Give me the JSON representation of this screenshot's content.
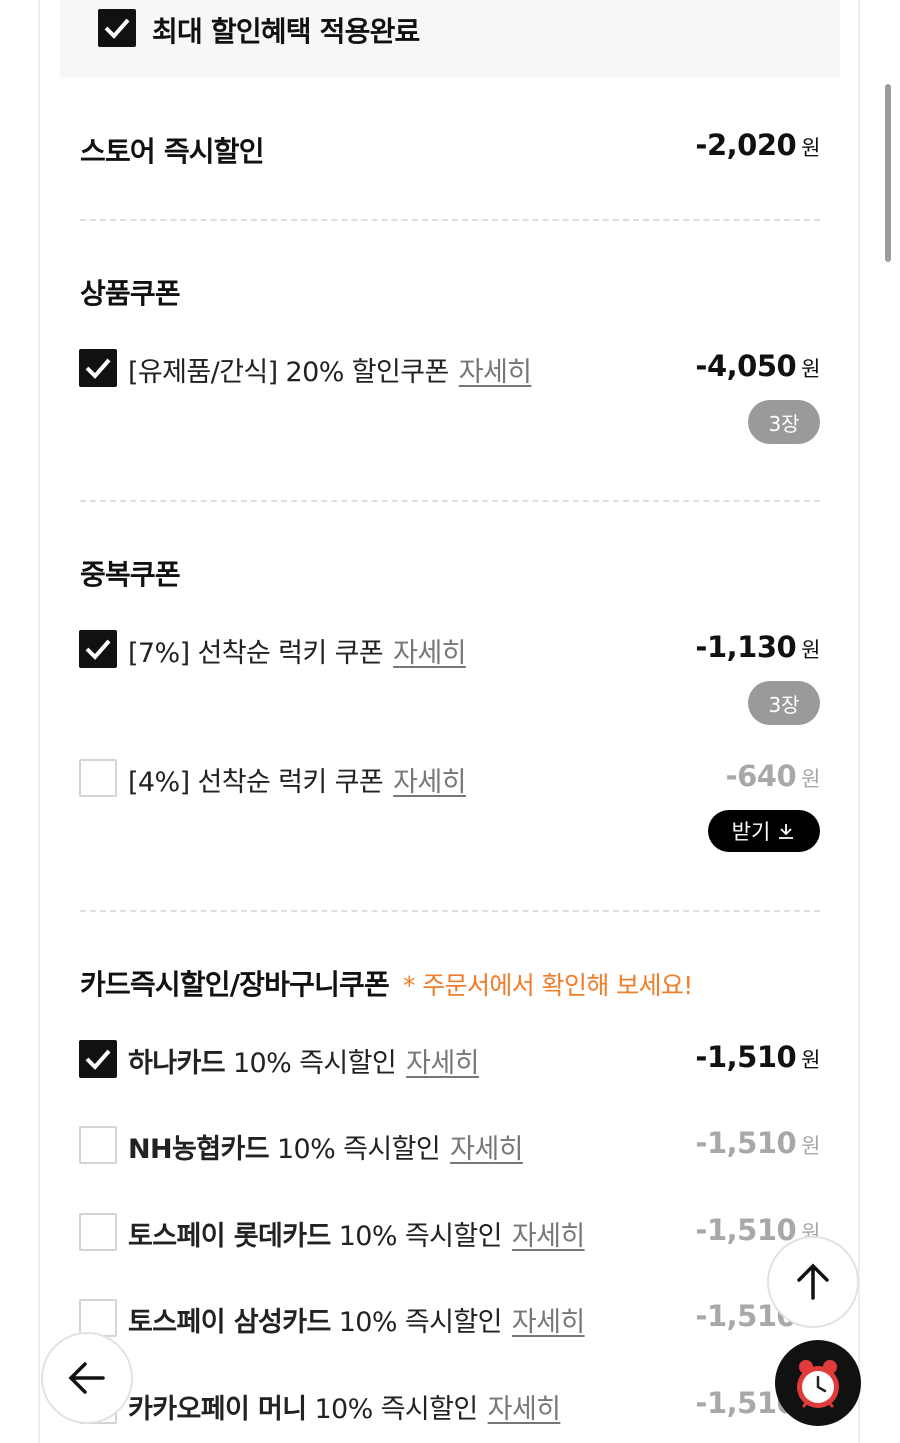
{
  "header": {
    "max_discount_label": "최대 할인혜택 적용완료"
  },
  "store_discount": {
    "label": "스토어 즉시할인",
    "amount": "-2,020",
    "unit": "원"
  },
  "product_coupon": {
    "title": "상품쿠폰",
    "items": [
      {
        "label": "[유제품/간식] 20% 할인쿠폰",
        "detail": "자세히",
        "amount": "-4,050",
        "unit": "원",
        "count": "3장",
        "checked": true
      }
    ]
  },
  "duplicate_coupon": {
    "title": "중복쿠폰",
    "items": [
      {
        "label": "[7%] 선착순 럭키 쿠폰",
        "detail": "자세히",
        "amount": "-1,130",
        "unit": "원",
        "count": "3장",
        "checked": true
      },
      {
        "label": "[4%] 선착순 럭키 쿠폰",
        "detail": "자세히",
        "amount": "-640",
        "unit": "원",
        "download": "받기",
        "checked": false
      }
    ]
  },
  "card_discount": {
    "title": "카드즉시할인/장바구니쿠폰",
    "note": "* 주문서에서 확인해 보세요!",
    "items": [
      {
        "brand": "하나카드",
        "label": "10% 즉시할인",
        "detail": "자세히",
        "amount": "-1,510",
        "unit": "원",
        "checked": true
      },
      {
        "brand": "NH농협카드",
        "label": "10% 즉시할인",
        "detail": "자세히",
        "amount": "-1,510",
        "unit": "원",
        "checked": false
      },
      {
        "brand": "토스페이 롯데카드",
        "label": "10% 즉시할인",
        "detail": "자세히",
        "amount": "-1,510",
        "unit": "원",
        "checked": false
      },
      {
        "brand": "토스페이 삼성카드",
        "label": "10% 즉시할인",
        "detail": "자세히",
        "amount": "-1,510",
        "unit": "원",
        "checked": false
      },
      {
        "brand": "카카오페이 머니",
        "label": "10% 즉시할인",
        "detail": "자세히",
        "amount": "-1,510",
        "unit": "원",
        "checked": false
      }
    ]
  },
  "floating": {
    "up_icon": "arrow-up-icon",
    "back_icon": "arrow-left-icon",
    "alarm_icon": "alarm-clock-icon"
  },
  "colors": {
    "accent_orange": "#f07d2a",
    "check_black": "#111111",
    "pill_gray": "#9a9a9a"
  }
}
